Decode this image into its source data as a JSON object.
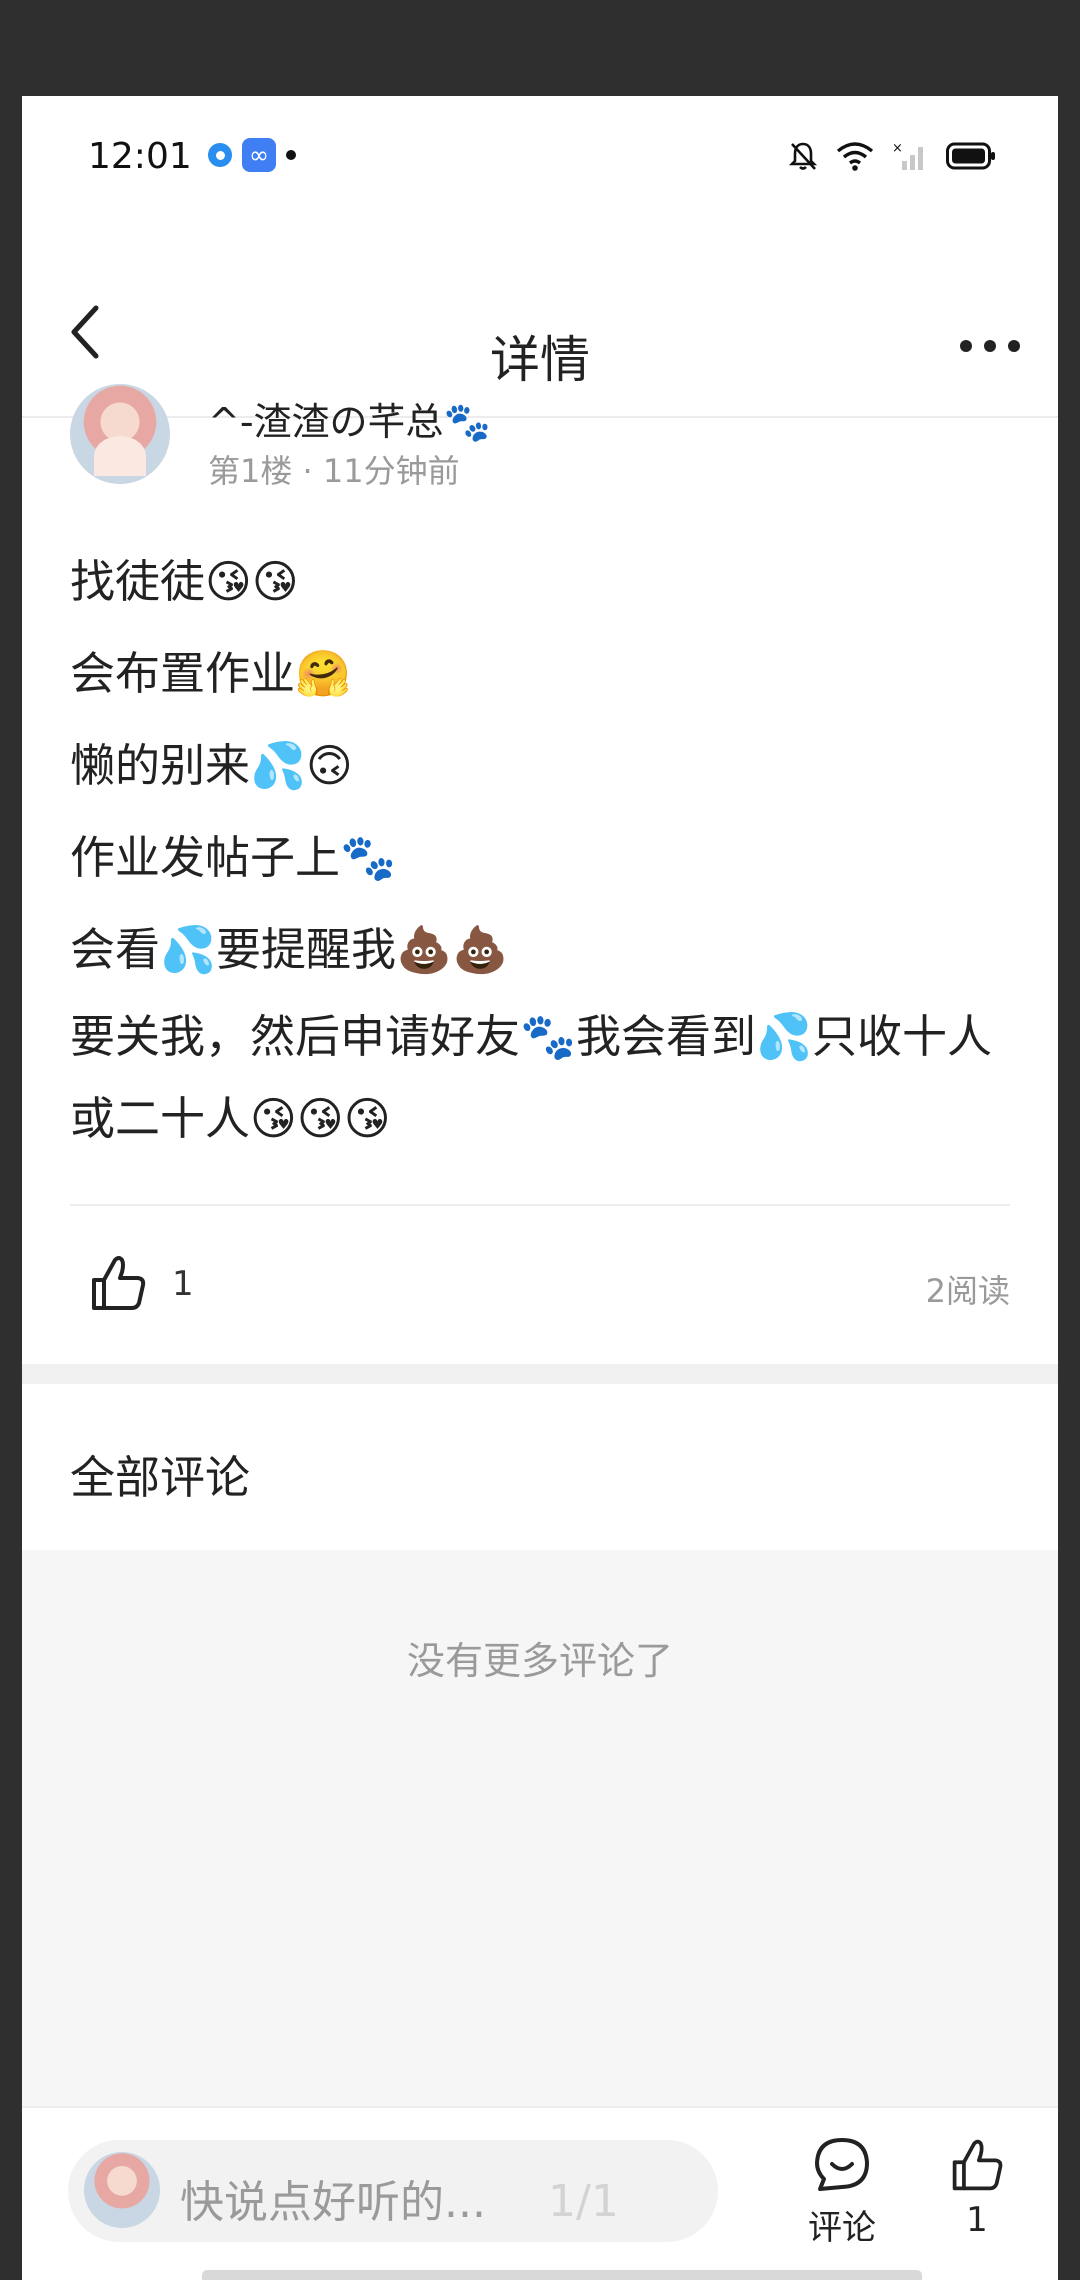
{
  "status_bar": {
    "time": "12:01",
    "icons": [
      "blue-circle-app-icon",
      "infinity-app-icon",
      "notification-dot",
      "muted-bell-icon",
      "wifi-icon",
      "no-signal-icon",
      "battery-icon"
    ]
  },
  "nav": {
    "title": "详情",
    "back_icon": "chevron-left-icon",
    "more_icon": "more-horizontal-icon"
  },
  "post": {
    "author": "^-渣渣の芊总🐾",
    "meta": "第1楼 · 11分钟前",
    "lines": [
      "找徒徒😘😘",
      "会布置作业🤗",
      "懒的别来💦🙃",
      "作业发帖子上🐾",
      "会看💦要提醒我💩💩",
      "要关我，然后申请好友🐾我会看到💦只收十人或二十人😘😘😘"
    ],
    "like_count": "1",
    "read_count": "2阅读"
  },
  "comments": {
    "heading": "全部评论",
    "empty_text": "没有更多评论了"
  },
  "bottom_bar": {
    "input_placeholder": "快说点好听的...",
    "page_indicator": "1/1",
    "comment_label": "评论",
    "like_label": "1"
  },
  "colors": {
    "text_primary": "#222222",
    "text_secondary": "#9a9a9a",
    "divider": "#ececec",
    "background_gray": "#f6f6f6"
  }
}
